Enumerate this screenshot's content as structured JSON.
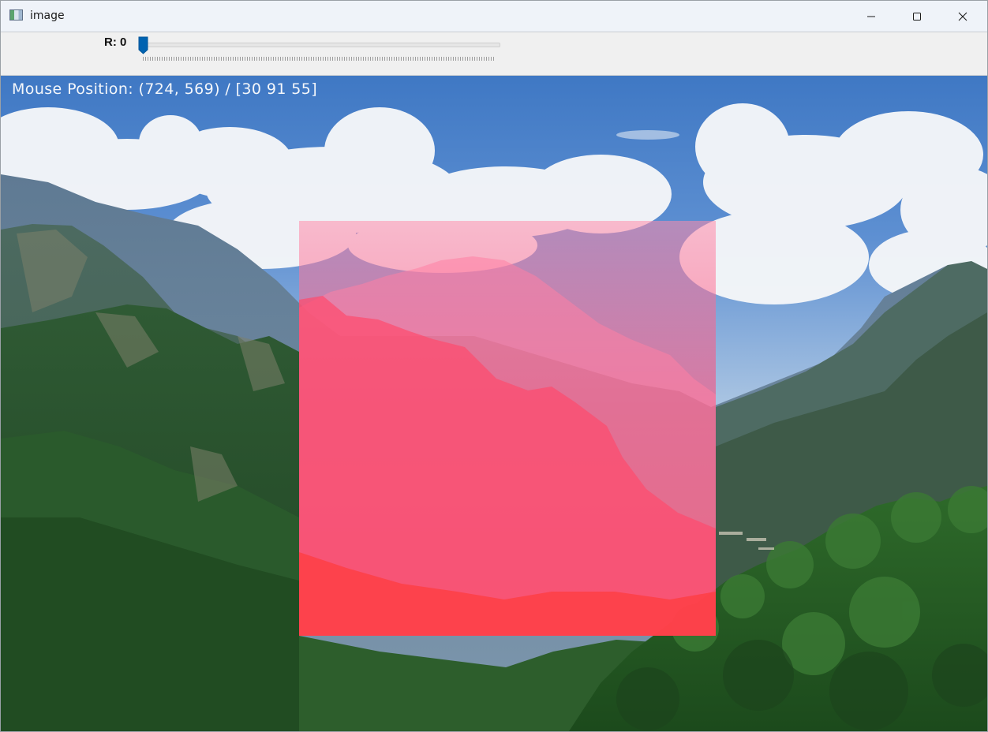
{
  "window": {
    "title": "image",
    "icon": "image-window-icon",
    "controls": [
      "minimize-icon",
      "maximize-icon",
      "close-icon"
    ]
  },
  "toolbar": {
    "trackbar_label": "R: 0",
    "trackbar_value": 0,
    "accent": "#0063b1"
  },
  "canvas": {
    "mouse_readout": "Mouse Position: (724, 569) / [30 91 55]",
    "overlay_color": "#ff3c6e"
  }
}
